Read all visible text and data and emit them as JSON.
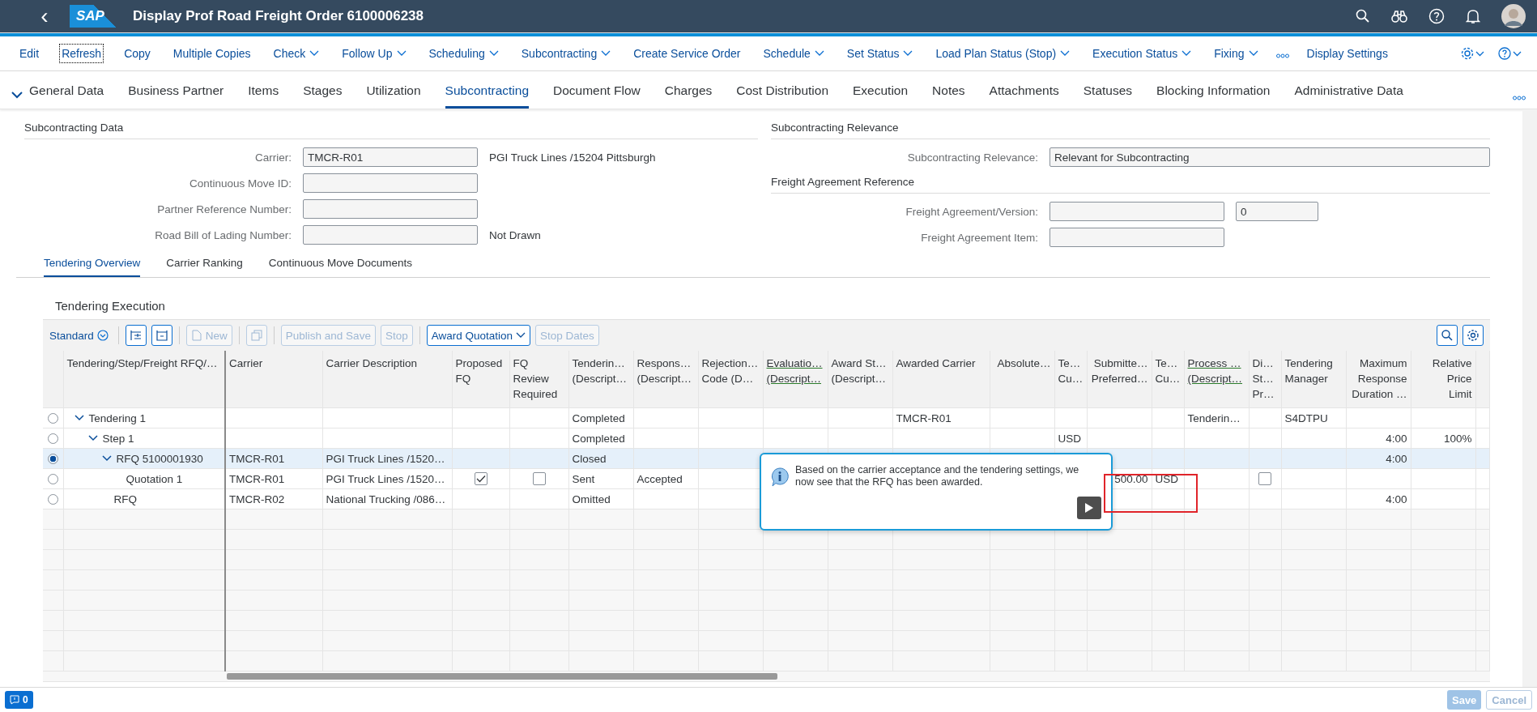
{
  "shell": {
    "back": "‹",
    "logo": "SAP",
    "title": "Display Prof Road Freight Order 6100006238"
  },
  "toolbar": [
    {
      "label": "Edit",
      "menu": false,
      "focused": false
    },
    {
      "label": "Refresh",
      "menu": false,
      "focused": true
    },
    {
      "label": "Copy",
      "menu": false,
      "focused": false
    },
    {
      "label": "Multiple Copies",
      "menu": false,
      "focused": false
    },
    {
      "label": "Check",
      "menu": true,
      "focused": false
    },
    {
      "label": "Follow Up",
      "menu": true,
      "focused": false
    },
    {
      "label": "Scheduling",
      "menu": true,
      "focused": false
    },
    {
      "label": "Subcontracting",
      "menu": true,
      "focused": false
    },
    {
      "label": "Create Service Order",
      "menu": false,
      "focused": false
    },
    {
      "label": "Schedule",
      "menu": true,
      "focused": false
    },
    {
      "label": "Set Status",
      "menu": true,
      "focused": false
    },
    {
      "label": "Load Plan Status (Stop)",
      "menu": true,
      "focused": false
    },
    {
      "label": "Execution Status",
      "menu": true,
      "focused": false
    },
    {
      "label": "Fixing",
      "menu": true,
      "focused": false
    },
    {
      "label": "Display Settings",
      "menu": false,
      "focused": false
    }
  ],
  "tabs": [
    {
      "label": "General Data",
      "selected": false
    },
    {
      "label": "Business Partner",
      "selected": false
    },
    {
      "label": "Items",
      "selected": false
    },
    {
      "label": "Stages",
      "selected": false
    },
    {
      "label": "Utilization",
      "selected": false
    },
    {
      "label": "Subcontracting",
      "selected": true
    },
    {
      "label": "Document Flow",
      "selected": false
    },
    {
      "label": "Charges",
      "selected": false
    },
    {
      "label": "Cost Distribution",
      "selected": false
    },
    {
      "label": "Execution",
      "selected": false
    },
    {
      "label": "Notes",
      "selected": false
    },
    {
      "label": "Attachments",
      "selected": false
    },
    {
      "label": "Statuses",
      "selected": false
    },
    {
      "label": "Blocking Information",
      "selected": false
    },
    {
      "label": "Administrative Data",
      "selected": false
    }
  ],
  "subcontracting_data": {
    "title": "Subcontracting Data",
    "fields": [
      {
        "label": "Carrier:",
        "value": "TMCR-R01",
        "note": "PGI Truck Lines /15204 Pittsburgh"
      },
      {
        "label": "Continuous Move ID:"
      },
      {
        "label": "Partner Reference Number:"
      },
      {
        "label": "Road Bill of Lading Number:",
        "note": "Not Drawn"
      }
    ]
  },
  "subcontracting_relevance": {
    "title": "Subcontracting Relevance",
    "label": "Subcontracting Relevance:",
    "value": "Relevant for Subcontracting"
  },
  "freight_agreement": {
    "title": "Freight Agreement Reference",
    "fields": [
      {
        "label": "Freight Agreement/Version:",
        "version": "0"
      },
      {
        "label": "Freight Agreement Item:"
      }
    ]
  },
  "sub_tabs": [
    {
      "label": "Tendering Overview",
      "selected": true
    },
    {
      "label": "Carrier Ranking",
      "selected": false
    },
    {
      "label": "Continuous Move Documents",
      "selected": false
    }
  ],
  "tendering": {
    "title": "Tendering Execution",
    "variant": "Standard",
    "buttons": [
      {
        "kind": "icon",
        "disabled": false
      },
      {
        "kind": "icon",
        "disabled": false
      },
      {
        "kind": "text",
        "label": "New",
        "disabled": true
      },
      {
        "kind": "icon",
        "disabled": true
      },
      {
        "kind": "text",
        "label": "Publish and Save",
        "disabled": true
      },
      {
        "kind": "text",
        "label": "Stop",
        "disabled": true
      },
      {
        "kind": "menu",
        "label": "Award Quotation",
        "disabled": false
      },
      {
        "kind": "text",
        "label": "Stop Dates",
        "disabled": true
      }
    ],
    "columns": [
      {
        "lines": [
          "Tendering/Step/Freight RFQ/…"
        ],
        "kind": "tree",
        "underlined": false
      },
      {
        "lines": [
          "Carrier"
        ],
        "kind": "text",
        "underlined": false
      },
      {
        "lines": [
          "Carrier Description"
        ],
        "kind": "text",
        "underlined": false
      },
      {
        "lines": [
          "Proposed",
          "FQ"
        ],
        "kind": "check",
        "underlined": false
      },
      {
        "lines": [
          "FQ",
          "Review",
          "Required"
        ],
        "kind": "check",
        "underlined": false
      },
      {
        "lines": [
          "Tenderin…",
          "(Descript…"
        ],
        "kind": "text",
        "underlined": false
      },
      {
        "lines": [
          "Respons…",
          "(Descript…"
        ],
        "kind": "text",
        "underlined": false
      },
      {
        "lines": [
          "Rejection…",
          "Code (D…"
        ],
        "kind": "text",
        "underlined": false
      },
      {
        "lines": [
          "Evaluatio…",
          "(Descript…"
        ],
        "kind": "text",
        "underlined": true
      },
      {
        "lines": [
          "Award St…",
          "(Descript…"
        ],
        "kind": "text",
        "underlined": false
      },
      {
        "lines": [
          "Awarded Carrier"
        ],
        "kind": "text",
        "underlined": false
      },
      {
        "lines": [
          "Absolute…"
        ],
        "kind": "number",
        "underlined": false
      },
      {
        "lines": [
          "Te…",
          "Cu…"
        ],
        "kind": "text",
        "underlined": false
      },
      {
        "lines": [
          "Submitte…",
          "Preferred…"
        ],
        "kind": "number",
        "underlined": false
      },
      {
        "lines": [
          "Te…",
          "Cu…"
        ],
        "kind": "text",
        "underlined": false
      },
      {
        "lines": [
          "Process …",
          "(Descript…"
        ],
        "kind": "text",
        "underlined": true
      },
      {
        "lines": [
          "Di…",
          "St…",
          "Pr…"
        ],
        "kind": "check",
        "underlined": false
      },
      {
        "lines": [
          "Tendering",
          "Manager"
        ],
        "kind": "text",
        "underlined": false
      },
      {
        "lines": [
          "Maximum",
          "Response",
          "Duration …"
        ],
        "kind": "number",
        "underlined": false
      },
      {
        "lines": [
          "Relative",
          "Price",
          "Limit"
        ],
        "kind": "number",
        "underlined": false
      }
    ],
    "rows": [
      {
        "selected": false,
        "expanded": true,
        "cells": [
          "Tendering  1",
          "",
          "",
          "",
          "",
          "Completed",
          "",
          "",
          "",
          "",
          "TMCR-R01",
          "",
          "",
          "",
          "",
          "Tenderin…",
          "",
          "S4DTPU",
          "",
          ""
        ],
        "children": [
          {
            "selected": false,
            "expanded": true,
            "cells": [
              "Step  1",
              "",
              "",
              "",
              "",
              "Completed",
              "",
              "",
              "",
              "",
              "",
              "",
              "USD",
              "",
              "",
              "",
              "",
              "",
              "4:00",
              "100%"
            ],
            "children": [
              {
                "selected": true,
                "expanded": true,
                "cells": [
                  "RFQ 5100001930",
                  "TMCR-R01",
                  "PGI Truck Lines /1520…",
                  "",
                  "",
                  "Closed",
                  "",
                  "",
                  "",
                  "",
                  "",
                  "",
                  "",
                  "",
                  "",
                  "",
                  "",
                  "",
                  "4:00",
                  ""
                ],
                "children": [
                  {
                    "selected": false,
                    "cells": [
                      "Quotation  1",
                      "TMCR-R01",
                      "PGI Truck Lines /1520…",
                      {
                        "checked": true
                      },
                      {
                        "checked": false
                      },
                      "Sent",
                      "Accepted",
                      "",
                      "",
                      "",
                      "",
                      "",
                      "",
                      "500.00",
                      "USD",
                      "",
                      {
                        "checked": false
                      },
                      "",
                      "",
                      ""
                    ]
                  }
                ]
              },
              {
                "selected": false,
                "cells": [
                  "RFQ",
                  "TMCR-R02",
                  "National Trucking /086…",
                  "",
                  "",
                  "Omitted",
                  "",
                  "",
                  "",
                  "",
                  "",
                  "",
                  "",
                  "",
                  "",
                  "",
                  "",
                  "",
                  "4:00",
                  ""
                ]
              }
            ]
          }
        ]
      }
    ]
  },
  "tooltip": {
    "text": "Based on the carrier acceptance and the tendering settings, we now see that the RFQ has been awarded."
  },
  "footer": {
    "messages": "0",
    "buttons": [
      {
        "label": "Save",
        "disabled": true,
        "kind": "primary"
      },
      {
        "label": "Cancel",
        "disabled": true,
        "kind": "secondary"
      }
    ]
  }
}
